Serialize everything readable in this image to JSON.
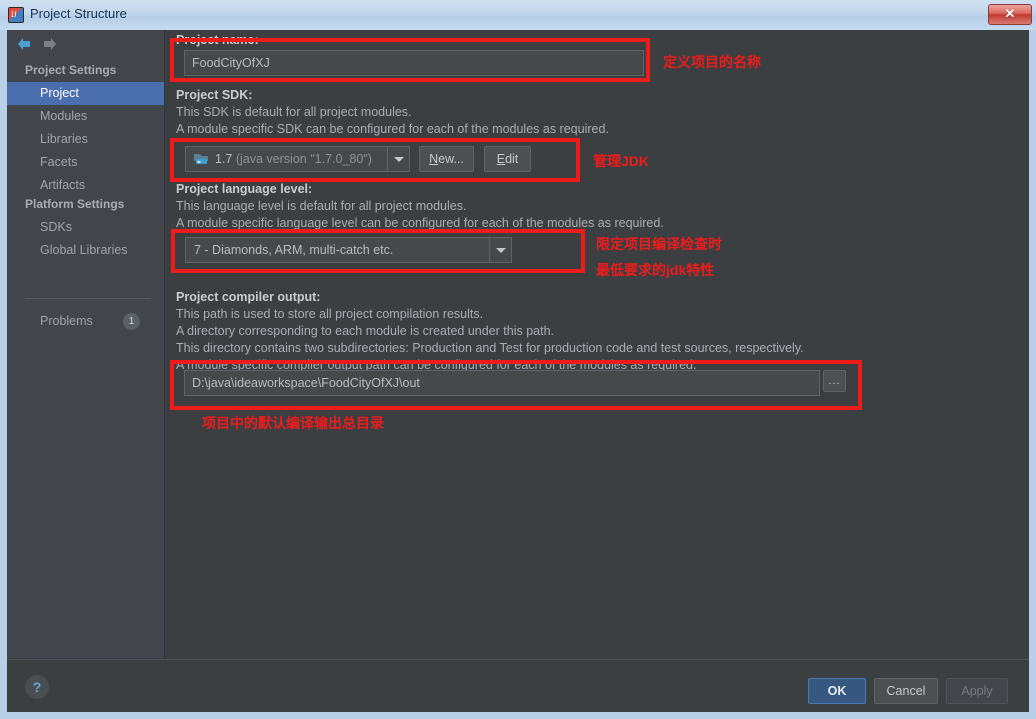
{
  "window": {
    "title": "Project Structure",
    "icon": "intellij-idea-icon",
    "close_label": "✕"
  },
  "sidebar": {
    "back_icon": "arrow-left-icon",
    "forward_icon": "arrow-right-icon",
    "project_settings_header": "Project Settings",
    "platform_settings_header": "Platform Settings",
    "project_items": [
      {
        "label": "Project"
      },
      {
        "label": "Modules"
      },
      {
        "label": "Libraries"
      },
      {
        "label": "Facets"
      },
      {
        "label": "Artifacts"
      }
    ],
    "platform_items": [
      {
        "label": "SDKs"
      },
      {
        "label": "Global Libraries"
      }
    ],
    "problems": {
      "label": "Problems",
      "count": "1"
    }
  },
  "main": {
    "project_name": {
      "label": "Project name:",
      "value": "FoodCityOfXJ"
    },
    "project_sdk": {
      "label": "Project SDK:",
      "desc1": "This SDK is default for all project modules.",
      "desc2": "A module specific SDK can be configured for each of the modules as required.",
      "sdk_version": "1.7",
      "sdk_detail": "(java version \"1.7.0_80\")",
      "sdk_icon": "jdk-folder-icon",
      "new_button": "New...",
      "new_button_mnemonic": "N",
      "edit_button": "Edit",
      "edit_button_mnemonic": "E"
    },
    "language_level": {
      "label": "Project language level:",
      "desc1": "This language level is default for all project modules.",
      "desc2": "A module specific language level can be configured for each of the modules as required.",
      "value": "7 - Diamonds, ARM, multi-catch etc."
    },
    "compiler_output": {
      "label": "Project compiler output:",
      "desc1": "This path is used to store all project compilation results.",
      "desc2": "A directory corresponding to each module is created under this path.",
      "desc3": "This directory contains two subdirectories: Production and Test for production code and test sources, respectively.",
      "desc4": "A module specific compiler output path can be configured for each of the modules as required.",
      "value": "D:\\java\\ideaworkspace\\FoodCityOfXJ\\out",
      "browse_button": "..."
    }
  },
  "annotations": {
    "color": "#ee1b1b",
    "project_name_note": "定义项目的名称",
    "sdk_note": "管理JDK",
    "language_level_note_line1": "限定项目编译检查时",
    "language_level_note_line2": "最低要求的jdk特性",
    "compiler_output_note": "项目中的默认编译输出总目录"
  },
  "footer": {
    "help_label": "?",
    "ok_label": "OK",
    "cancel_label": "Cancel",
    "apply_label": "Apply"
  },
  "colors": {
    "selection": "#4b6eaf",
    "panel": "#3c3f41",
    "sidebar": "#42464c",
    "annotation_red": "#ee1b1b",
    "ok_button": "#365880"
  }
}
